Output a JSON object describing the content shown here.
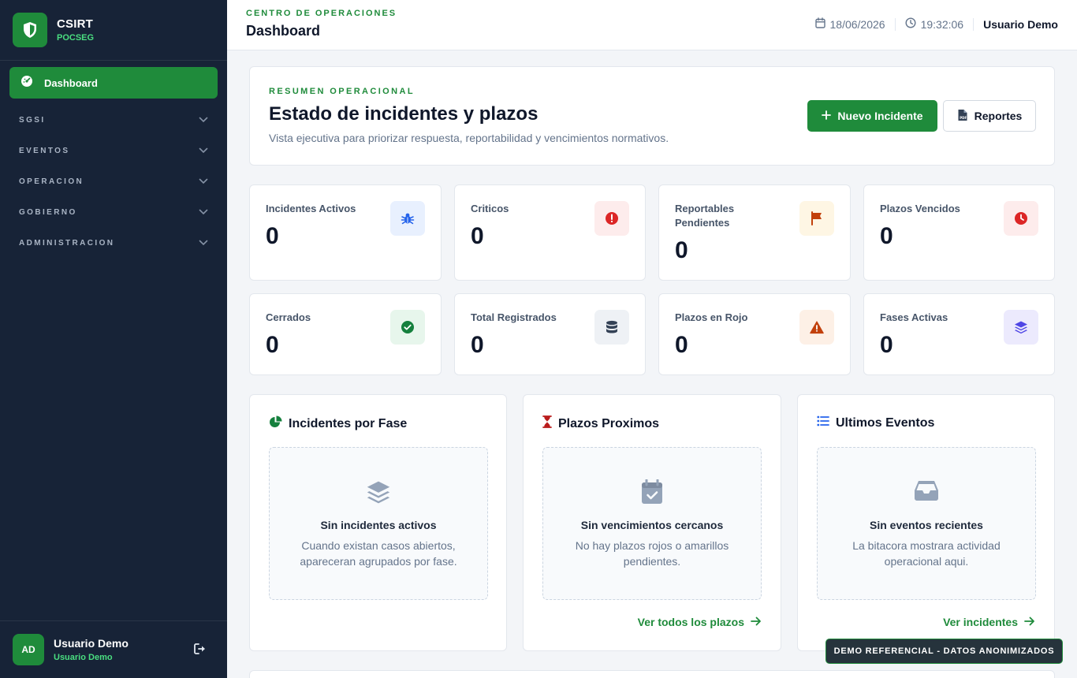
{
  "brand": {
    "title": "CSIRT",
    "subtitle": "POCSEG"
  },
  "sidebar": {
    "active_item": {
      "label": "Dashboard",
      "icon": "gauge-icon"
    },
    "groups": [
      {
        "label": "SGSI"
      },
      {
        "label": "EVENTOS"
      },
      {
        "label": "OPERACION"
      },
      {
        "label": "GOBIERNO"
      },
      {
        "label": "ADMINISTRACION"
      }
    ],
    "user": {
      "initials": "AD",
      "name": "Usuario Demo",
      "role": "Usuario Demo"
    }
  },
  "header": {
    "kicker": "CENTRO DE OPERACIONES",
    "title": "Dashboard",
    "date": "18/06/2026",
    "time": "19:32:06",
    "user": "Usuario Demo"
  },
  "summary": {
    "kicker": "RESUMEN OPERACIONAL",
    "title": "Estado de incidentes y plazos",
    "description": "Vista ejecutiva para priorizar respuesta, reportabilidad y vencimientos normativos.",
    "primary_button": "Nuevo Incidente",
    "secondary_button": "Reportes"
  },
  "stats": [
    {
      "label": "Incidentes Activos",
      "value": "0",
      "icon": "bug-icon"
    },
    {
      "label": "Criticos",
      "value": "0",
      "icon": "alert-circle-icon"
    },
    {
      "label": "Reportables Pendientes",
      "value": "0",
      "icon": "flag-icon"
    },
    {
      "label": "Plazos Vencidos",
      "value": "0",
      "icon": "clock-icon"
    },
    {
      "label": "Cerrados",
      "value": "0",
      "icon": "check-circle-icon"
    },
    {
      "label": "Total Registrados",
      "value": "0",
      "icon": "database-icon"
    },
    {
      "label": "Plazos en Rojo",
      "value": "0",
      "icon": "warning-icon"
    },
    {
      "label": "Fases Activas",
      "value": "0",
      "icon": "layers-icon"
    }
  ],
  "panels": [
    {
      "title": "Incidentes por Fase",
      "icon": "pie-chart-icon",
      "empty_title": "Sin incidentes activos",
      "empty_desc": "Cuando existan casos abiertos, apareceran agrupados por fase.",
      "empty_icon": "layers-icon"
    },
    {
      "title": "Plazos Proximos",
      "icon": "hourglass-icon",
      "empty_title": "Sin vencimientos cercanos",
      "empty_desc": "No hay plazos rojos o amarillos pendientes.",
      "empty_icon": "calendar-check-icon",
      "link": "Ver todos los plazos"
    },
    {
      "title": "Ultimos Eventos",
      "icon": "list-icon",
      "empty_title": "Sin eventos recientes",
      "empty_desc": "La bitacora mostrara actividad operacional aqui.",
      "empty_icon": "inbox-icon",
      "link": "Ver incidentes"
    }
  ],
  "demo_badge": "DEMO REFERENCIAL - DATOS ANONIMIZADOS",
  "colors": {
    "sidebar_bg": "#172337",
    "accent": "#1f8b3b",
    "accent_light": "#4ade80",
    "page_bg": "#f3f5f8"
  }
}
